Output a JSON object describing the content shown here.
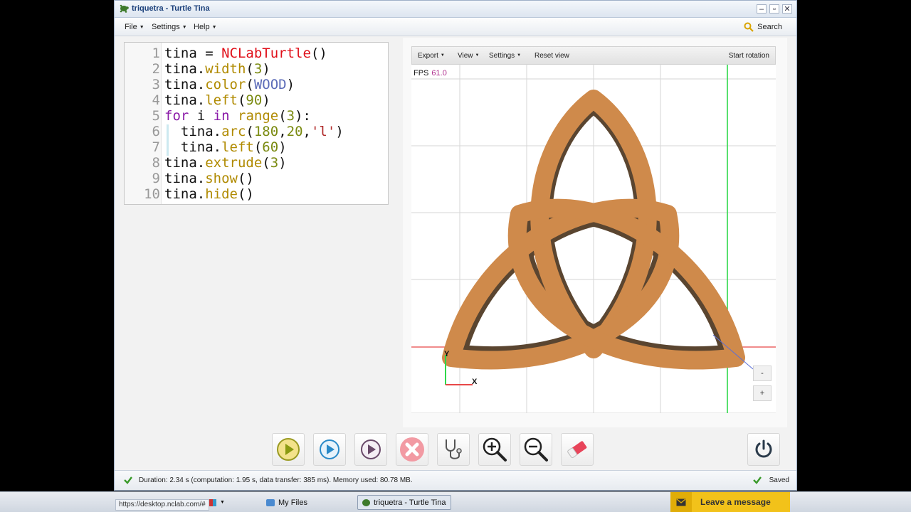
{
  "window": {
    "title": "triquetra - Turtle Tina"
  },
  "menubar": {
    "file": "File",
    "settings": "Settings",
    "help": "Help",
    "search": "Search"
  },
  "editor": {
    "lines": [
      {
        "num": "1",
        "code": "tina = NCLabTurtle()"
      },
      {
        "num": "2",
        "code": "tina.width(3)"
      },
      {
        "num": "3",
        "code": "tina.color(WOOD)"
      },
      {
        "num": "4",
        "code": "tina.left(90)"
      },
      {
        "num": "5",
        "code": "for i in range(3):"
      },
      {
        "num": "6",
        "code": "  tina.arc(180,20,'l')"
      },
      {
        "num": "7",
        "code": "  tina.left(60)"
      },
      {
        "num": "8",
        "code": "tina.extrude(3)"
      },
      {
        "num": "9",
        "code": "tina.show()"
      },
      {
        "num": "10",
        "code": "tina.hide()"
      }
    ]
  },
  "viewer": {
    "export": "Export",
    "view": "View",
    "settings": "Settings",
    "reset": "Reset view",
    "rotation": "Start rotation",
    "fps_label": "FPS",
    "fps_value": "61.0",
    "axis_x": "X",
    "axis_y": "Y",
    "zoom_out": "-",
    "zoom_in": "+",
    "colors": {
      "wood": "#cf8a4b",
      "wood_dark": "#5a4530",
      "x_axis": "#e84848",
      "y_axis": "#2fd84a"
    }
  },
  "toolbar": {
    "buttons": [
      "play-button",
      "step-button",
      "debug-play-button",
      "stop-button",
      "diagnose-button",
      "zoom-in-button",
      "zoom-out-button",
      "clear-button",
      "power-button"
    ]
  },
  "status": {
    "message": "Duration: 2.34 s (computation: 1.95 s, data transfer: 385 ms). Memory used: 80.78 MB.",
    "saved": "Saved"
  },
  "taskbar": {
    "url": "https://desktop.nclab.com/#",
    "myfiles": "My Files",
    "active_window": "triquetra - Turtle Tina",
    "leave_message": "Leave a message"
  }
}
